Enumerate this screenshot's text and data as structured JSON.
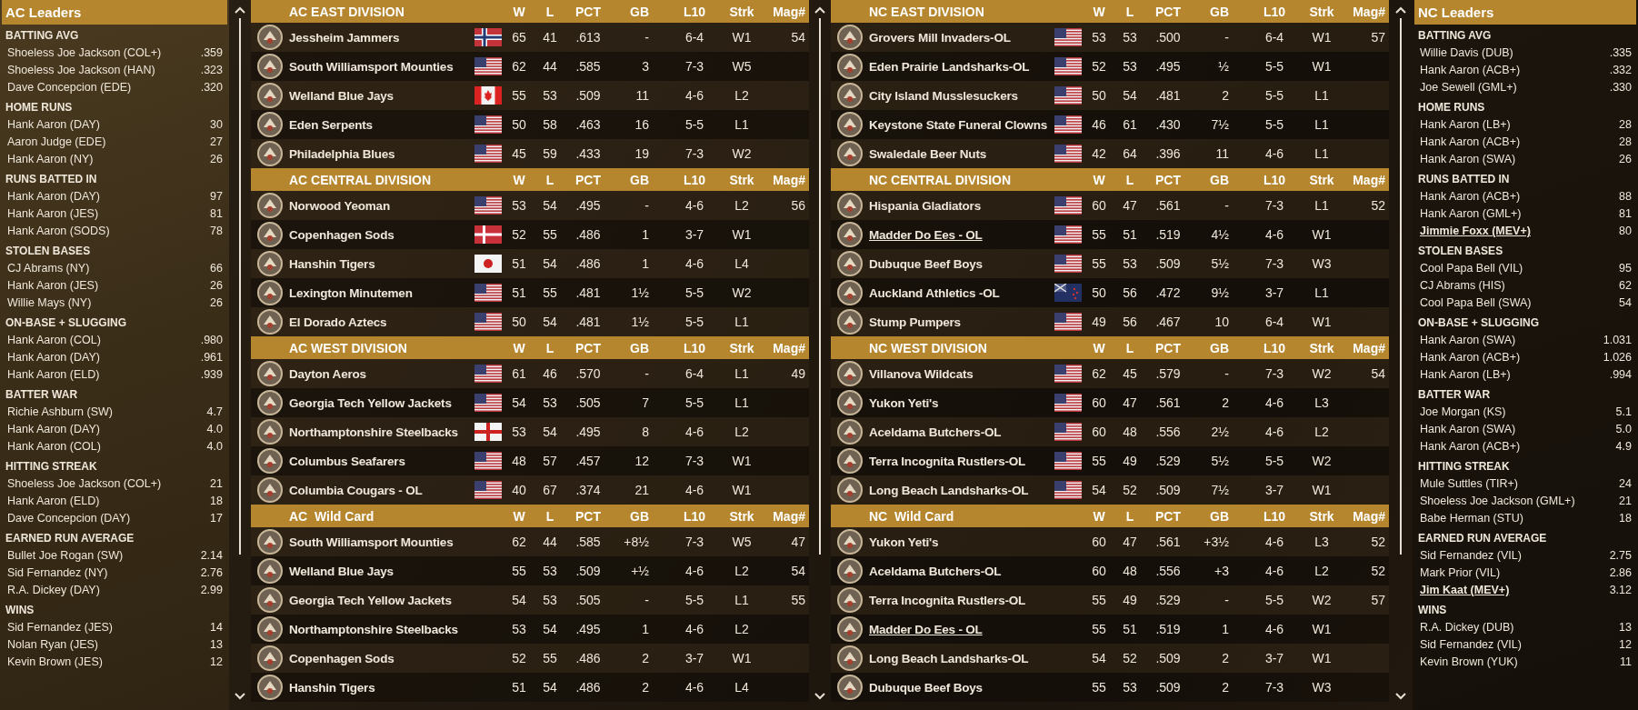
{
  "ac_leaders": {
    "title": "AC Leaders",
    "categories": [
      {
        "heading": "BATTING AVG",
        "leaders": [
          {
            "name": "Shoeless Joe Jackson (COL+)",
            "value": ".359",
            "user_team": false
          },
          {
            "name": "Shoeless Joe Jackson (HAN)",
            "value": ".323",
            "user_team": false
          },
          {
            "name": "Dave Concepcion (EDE)",
            "value": ".320",
            "user_team": false
          }
        ]
      },
      {
        "heading": "HOME RUNS",
        "leaders": [
          {
            "name": "Hank Aaron (DAY)",
            "value": "30",
            "user_team": false
          },
          {
            "name": "Aaron Judge (EDE)",
            "value": "27",
            "user_team": false
          },
          {
            "name": "Hank Aaron (NY)",
            "value": "26",
            "user_team": false
          }
        ]
      },
      {
        "heading": "RUNS BATTED IN",
        "leaders": [
          {
            "name": "Hank Aaron (DAY)",
            "value": "97",
            "user_team": false
          },
          {
            "name": "Hank Aaron (JES)",
            "value": "81",
            "user_team": false
          },
          {
            "name": "Hank Aaron (SODS)",
            "value": "78",
            "user_team": false
          }
        ]
      },
      {
        "heading": "STOLEN BASES",
        "leaders": [
          {
            "name": "CJ Abrams (NY)",
            "value": "66",
            "user_team": false
          },
          {
            "name": "Hank Aaron (JES)",
            "value": "26",
            "user_team": false
          },
          {
            "name": "Willie Mays (NY)",
            "value": "26",
            "user_team": false
          }
        ]
      },
      {
        "heading": "ON-BASE + SLUGGING",
        "leaders": [
          {
            "name": "Hank Aaron (COL)",
            "value": ".980",
            "user_team": false
          },
          {
            "name": "Hank Aaron (DAY)",
            "value": ".961",
            "user_team": false
          },
          {
            "name": "Hank Aaron (ELD)",
            "value": ".939",
            "user_team": false
          }
        ]
      },
      {
        "heading": "BATTER WAR",
        "leaders": [
          {
            "name": "Richie Ashburn (SW)",
            "value": "4.7",
            "user_team": false
          },
          {
            "name": "Hank Aaron (DAY)",
            "value": "4.0",
            "user_team": false
          },
          {
            "name": "Hank Aaron (COL)",
            "value": "4.0",
            "user_team": false
          }
        ]
      },
      {
        "heading": "HITTING STREAK",
        "leaders": [
          {
            "name": "Shoeless Joe Jackson (COL+)",
            "value": "21",
            "user_team": false
          },
          {
            "name": "Hank Aaron (ELD)",
            "value": "18",
            "user_team": false
          },
          {
            "name": "Dave Concepcion (DAY)",
            "value": "17",
            "user_team": false
          }
        ]
      },
      {
        "heading": "EARNED RUN AVERAGE",
        "leaders": [
          {
            "name": "Bullet Joe Rogan (SW)",
            "value": "2.14",
            "user_team": false
          },
          {
            "name": "Sid Fernandez (NY)",
            "value": "2.76",
            "user_team": false
          },
          {
            "name": "R.A. Dickey (DAY)",
            "value": "2.99",
            "user_team": false
          }
        ]
      },
      {
        "heading": "WINS",
        "leaders": [
          {
            "name": "Sid Fernandez (JES)",
            "value": "14",
            "user_team": false
          },
          {
            "name": "Nolan Ryan (JES)",
            "value": "13",
            "user_team": false
          },
          {
            "name": "Kevin Brown (JES)",
            "value": "12",
            "user_team": false
          }
        ]
      }
    ]
  },
  "ac_standings": [
    {
      "title": "AC EAST DIVISION",
      "columns": [
        "W",
        "L",
        "PCT",
        "GB",
        "L10",
        "Strk",
        "Mag#"
      ],
      "teams": [
        {
          "name": "Jessheim Jammers",
          "kind": "no",
          "w": "65",
          "l": "41",
          "pct": ".613",
          "gb": "-",
          "l10": "6-4",
          "strk": "W1",
          "mag": "54",
          "user_team": false
        },
        {
          "name": "South Williamsport Mounties",
          "kind": "us",
          "w": "62",
          "l": "44",
          "pct": ".585",
          "gb": "3",
          "l10": "7-3",
          "strk": "W5",
          "user_team": false
        },
        {
          "name": "Welland Blue Jays",
          "kind": "ca",
          "w": "55",
          "l": "53",
          "pct": ".509",
          "gb": "11",
          "l10": "4-6",
          "strk": "L2",
          "user_team": false
        },
        {
          "name": "Eden Serpents",
          "kind": "us",
          "w": "50",
          "l": "58",
          "pct": ".463",
          "gb": "16",
          "l10": "5-5",
          "strk": "L1",
          "user_team": false
        },
        {
          "name": "Philadelphia Blues",
          "kind": "us",
          "w": "45",
          "l": "59",
          "pct": ".433",
          "gb": "19",
          "l10": "7-3",
          "strk": "W2",
          "user_team": false
        }
      ]
    },
    {
      "title": "AC CENTRAL DIVISION",
      "columns": [
        "W",
        "L",
        "PCT",
        "GB",
        "L10",
        "Strk",
        "Mag#"
      ],
      "teams": [
        {
          "name": "Norwood Yeoman",
          "kind": "us",
          "w": "53",
          "l": "54",
          "pct": ".495",
          "gb": "-",
          "l10": "4-6",
          "strk": "L2",
          "mag": "56",
          "user_team": false
        },
        {
          "name": "Copenhagen Sods",
          "kind": "dk",
          "w": "52",
          "l": "55",
          "pct": ".486",
          "gb": "1",
          "l10": "3-7",
          "strk": "W1",
          "user_team": false
        },
        {
          "name": "Hanshin Tigers",
          "kind": "jp",
          "w": "51",
          "l": "54",
          "pct": ".486",
          "gb": "1",
          "l10": "4-6",
          "strk": "L4",
          "user_team": false
        },
        {
          "name": "Lexington Minutemen",
          "kind": "us",
          "w": "51",
          "l": "55",
          "pct": ".481",
          "gb": "1½",
          "l10": "5-5",
          "strk": "W2",
          "user_team": false
        },
        {
          "name": "El Dorado Aztecs",
          "kind": "us",
          "w": "50",
          "l": "54",
          "pct": ".481",
          "gb": "1½",
          "l10": "5-5",
          "strk": "L1",
          "user_team": false
        }
      ]
    },
    {
      "title": "AC WEST DIVISION",
      "columns": [
        "W",
        "L",
        "PCT",
        "GB",
        "L10",
        "Strk",
        "Mag#"
      ],
      "teams": [
        {
          "name": "Dayton Aeros",
          "kind": "us",
          "w": "61",
          "l": "46",
          "pct": ".570",
          "gb": "-",
          "l10": "6-4",
          "strk": "L1",
          "mag": "49",
          "user_team": false
        },
        {
          "name": "Georgia Tech Yellow Jackets",
          "kind": "us",
          "w": "54",
          "l": "53",
          "pct": ".505",
          "gb": "7",
          "l10": "5-5",
          "strk": "L1",
          "user_team": false
        },
        {
          "name": "Northamptonshire Steelbacks",
          "kind": "england",
          "w": "53",
          "l": "54",
          "pct": ".495",
          "gb": "8",
          "l10": "4-6",
          "strk": "L2",
          "user_team": false
        },
        {
          "name": "Columbus Seafarers",
          "kind": "us",
          "w": "48",
          "l": "57",
          "pct": ".457",
          "gb": "12",
          "l10": "7-3",
          "strk": "W1",
          "user_team": false
        },
        {
          "name": "Columbia Cougars - OL",
          "kind": "us",
          "w": "40",
          "l": "67",
          "pct": ".374",
          "gb": "21",
          "l10": "4-6",
          "strk": "W1",
          "user_team": false
        }
      ]
    },
    {
      "title": "AC  Wild Card",
      "columns": [
        "W",
        "L",
        "PCT",
        "GB",
        "L10",
        "Strk",
        "Mag#"
      ],
      "teams": [
        {
          "name": "South Williamsport Mounties",
          "w": "62",
          "l": "44",
          "pct": ".585",
          "gb": "+8½",
          "l10": "7-3",
          "strk": "W5",
          "mag": "47",
          "user_team": false
        },
        {
          "name": "Welland Blue Jays",
          "w": "55",
          "l": "53",
          "pct": ".509",
          "gb": "+½",
          "l10": "4-6",
          "strk": "L2",
          "mag": "54",
          "user_team": false
        },
        {
          "name": "Georgia Tech Yellow Jackets",
          "w": "54",
          "l": "53",
          "pct": ".505",
          "gb": "-",
          "l10": "5-5",
          "strk": "L1",
          "mag": "55",
          "user_team": false
        },
        {
          "name": "Northamptonshire Steelbacks",
          "w": "53",
          "l": "54",
          "pct": ".495",
          "gb": "1",
          "l10": "4-6",
          "strk": "L2",
          "user_team": false
        },
        {
          "name": "Copenhagen Sods",
          "w": "52",
          "l": "55",
          "pct": ".486",
          "gb": "2",
          "l10": "3-7",
          "strk": "W1",
          "user_team": false
        },
        {
          "name": "Hanshin Tigers",
          "w": "51",
          "l": "54",
          "pct": ".486",
          "gb": "2",
          "l10": "4-6",
          "strk": "L4",
          "user_team": false
        }
      ]
    }
  ],
  "nc_standings": [
    {
      "title": "NC EAST DIVISION",
      "columns": [
        "W",
        "L",
        "PCT",
        "GB",
        "L10",
        "Strk",
        "Mag#"
      ],
      "teams": [
        {
          "name": "Grovers Mill Invaders-OL",
          "kind": "us",
          "w": "53",
          "l": "53",
          "pct": ".500",
          "gb": "-",
          "l10": "6-4",
          "strk": "W1",
          "mag": "57",
          "user_team": false
        },
        {
          "name": "Eden Prairie Landsharks-OL",
          "kind": "us",
          "w": "52",
          "l": "53",
          "pct": ".495",
          "gb": "½",
          "l10": "5-5",
          "strk": "W1",
          "user_team": false
        },
        {
          "name": "City Island Musslesuckers",
          "kind": "us",
          "w": "50",
          "l": "54",
          "pct": ".481",
          "gb": "2",
          "l10": "5-5",
          "strk": "L1",
          "user_team": false
        },
        {
          "name": "Keystone State Funeral Clowns",
          "kind": "us",
          "w": "46",
          "l": "61",
          "pct": ".430",
          "gb": "7½",
          "l10": "5-5",
          "strk": "L1",
          "user_team": false
        },
        {
          "name": "Swaledale Beer Nuts",
          "kind": "us",
          "w": "42",
          "l": "64",
          "pct": ".396",
          "gb": "11",
          "l10": "4-6",
          "strk": "L1",
          "user_team": false
        }
      ]
    },
    {
      "title": "NC CENTRAL DIVISION",
      "columns": [
        "W",
        "L",
        "PCT",
        "GB",
        "L10",
        "Strk",
        "Mag#"
      ],
      "teams": [
        {
          "name": "Hispania Gladiators",
          "kind": "us",
          "w": "60",
          "l": "47",
          "pct": ".561",
          "gb": "-",
          "l10": "7-3",
          "strk": "L1",
          "mag": "52",
          "user_team": false
        },
        {
          "name": "Madder Do Ees - OL",
          "kind": "us",
          "w": "55",
          "l": "51",
          "pct": ".519",
          "gb": "4½",
          "l10": "4-6",
          "strk": "W1",
          "user_team": true
        },
        {
          "name": "Dubuque Beef Boys",
          "kind": "us",
          "w": "55",
          "l": "53",
          "pct": ".509",
          "gb": "5½",
          "l10": "7-3",
          "strk": "W3",
          "user_team": false
        },
        {
          "name": "Auckland Athletics -OL",
          "kind": "nz",
          "w": "50",
          "l": "56",
          "pct": ".472",
          "gb": "9½",
          "l10": "3-7",
          "strk": "L1",
          "user_team": false
        },
        {
          "name": "Stump Pumpers",
          "kind": "us",
          "w": "49",
          "l": "56",
          "pct": ".467",
          "gb": "10",
          "l10": "6-4",
          "strk": "W1",
          "user_team": false
        }
      ]
    },
    {
      "title": "NC WEST DIVISION",
      "columns": [
        "W",
        "L",
        "PCT",
        "GB",
        "L10",
        "Strk",
        "Mag#"
      ],
      "teams": [
        {
          "name": "Villanova Wildcats",
          "kind": "us",
          "w": "62",
          "l": "45",
          "pct": ".579",
          "gb": "-",
          "l10": "7-3",
          "strk": "W2",
          "mag": "54",
          "user_team": false
        },
        {
          "name": "Yukon Yeti's",
          "kind": "us",
          "w": "60",
          "l": "47",
          "pct": ".561",
          "gb": "2",
          "l10": "4-6",
          "strk": "L3",
          "user_team": false
        },
        {
          "name": "Aceldama Butchers-OL",
          "kind": "us",
          "w": "60",
          "l": "48",
          "pct": ".556",
          "gb": "2½",
          "l10": "4-6",
          "strk": "L2",
          "user_team": false
        },
        {
          "name": "Terra Incognita Rustlers-OL",
          "kind": "us",
          "w": "55",
          "l": "49",
          "pct": ".529",
          "gb": "5½",
          "l10": "5-5",
          "strk": "W2",
          "user_team": false
        },
        {
          "name": "Long Beach Landsharks-OL",
          "kind": "us",
          "w": "54",
          "l": "52",
          "pct": ".509",
          "gb": "7½",
          "l10": "3-7",
          "strk": "W1",
          "user_team": false
        }
      ]
    },
    {
      "title": "NC  Wild Card",
      "columns": [
        "W",
        "L",
        "PCT",
        "GB",
        "L10",
        "Strk",
        "Mag#"
      ],
      "teams": [
        {
          "name": "Yukon Yeti's",
          "w": "60",
          "l": "47",
          "pct": ".561",
          "gb": "+3½",
          "l10": "4-6",
          "strk": "L3",
          "mag": "52",
          "user_team": false
        },
        {
          "name": "Aceldama Butchers-OL",
          "w": "60",
          "l": "48",
          "pct": ".556",
          "gb": "+3",
          "l10": "4-6",
          "strk": "L2",
          "mag": "52",
          "user_team": false
        },
        {
          "name": "Terra Incognita Rustlers-OL",
          "w": "55",
          "l": "49",
          "pct": ".529",
          "gb": "-",
          "l10": "5-5",
          "strk": "W2",
          "mag": "57",
          "user_team": false
        },
        {
          "name": "Madder Do Ees - OL",
          "w": "55",
          "l": "51",
          "pct": ".519",
          "gb": "1",
          "l10": "4-6",
          "strk": "W1",
          "user_team": true
        },
        {
          "name": "Long Beach Landsharks-OL",
          "w": "54",
          "l": "52",
          "pct": ".509",
          "gb": "2",
          "l10": "3-7",
          "strk": "W1",
          "user_team": false
        },
        {
          "name": "Dubuque Beef Boys",
          "w": "55",
          "l": "53",
          "pct": ".509",
          "gb": "2",
          "l10": "7-3",
          "strk": "W3",
          "user_team": false
        }
      ]
    }
  ],
  "nc_leaders": {
    "title": "NC Leaders",
    "categories": [
      {
        "heading": "BATTING AVG",
        "leaders": [
          {
            "name": "Willie Davis (DUB)",
            "value": ".335",
            "user_team": false
          },
          {
            "name": "Hank Aaron (ACB+)",
            "value": ".332",
            "user_team": false
          },
          {
            "name": "Joe Sewell (GML+)",
            "value": ".330",
            "user_team": false
          }
        ]
      },
      {
        "heading": "HOME RUNS",
        "leaders": [
          {
            "name": "Hank Aaron (LB+)",
            "value": "28",
            "user_team": false
          },
          {
            "name": "Hank Aaron (ACB+)",
            "value": "28",
            "user_team": false
          },
          {
            "name": "Hank Aaron (SWA)",
            "value": "26",
            "user_team": false
          }
        ]
      },
      {
        "heading": "RUNS BATTED IN",
        "leaders": [
          {
            "name": "Hank Aaron (ACB+)",
            "value": "88",
            "user_team": false
          },
          {
            "name": "Hank Aaron (GML+)",
            "value": "81",
            "user_team": false
          },
          {
            "name": "Jimmie Foxx (MEV+)",
            "value": "80",
            "user_team": true
          }
        ]
      },
      {
        "heading": "STOLEN BASES",
        "leaders": [
          {
            "name": "Cool Papa Bell (VIL)",
            "value": "95",
            "user_team": false
          },
          {
            "name": "CJ Abrams (HIS)",
            "value": "62",
            "user_team": false
          },
          {
            "name": "Cool Papa Bell (SWA)",
            "value": "54",
            "user_team": false
          }
        ]
      },
      {
        "heading": "ON-BASE + SLUGGING",
        "leaders": [
          {
            "name": "Hank Aaron (SWA)",
            "value": "1.031",
            "user_team": false
          },
          {
            "name": "Hank Aaron (ACB+)",
            "value": "1.026",
            "user_team": false
          },
          {
            "name": "Hank Aaron (LB+)",
            "value": ".994",
            "user_team": false
          }
        ]
      },
      {
        "heading": "BATTER WAR",
        "leaders": [
          {
            "name": "Joe Morgan (KS)",
            "value": "5.1",
            "user_team": false
          },
          {
            "name": "Hank Aaron (SWA)",
            "value": "5.0",
            "user_team": false
          },
          {
            "name": "Hank Aaron (ACB+)",
            "value": "4.9",
            "user_team": false
          }
        ]
      },
      {
        "heading": "HITTING STREAK",
        "leaders": [
          {
            "name": "Mule Suttles (TIR+)",
            "value": "24",
            "user_team": false
          },
          {
            "name": "Shoeless Joe Jackson (GML+)",
            "value": "21",
            "user_team": false
          },
          {
            "name": "Babe Herman (STU)",
            "value": "18",
            "user_team": false
          }
        ]
      },
      {
        "heading": "EARNED RUN AVERAGE",
        "leaders": [
          {
            "name": "Sid Fernandez (VIL)",
            "value": "2.75",
            "user_team": false
          },
          {
            "name": "Mark Prior (VIL)",
            "value": "2.86",
            "user_team": false
          },
          {
            "name": "Jim Kaat (MEV+)",
            "value": "3.12",
            "user_team": true
          }
        ]
      },
      {
        "heading": "WINS",
        "leaders": [
          {
            "name": "R.A. Dickey (DUB)",
            "value": "13",
            "user_team": false
          },
          {
            "name": "Sid Fernandez (VIL)",
            "value": "12",
            "user_team": false
          },
          {
            "name": "Kevin Brown (YUK)",
            "value": "11",
            "user_team": false
          }
        ]
      }
    ]
  }
}
